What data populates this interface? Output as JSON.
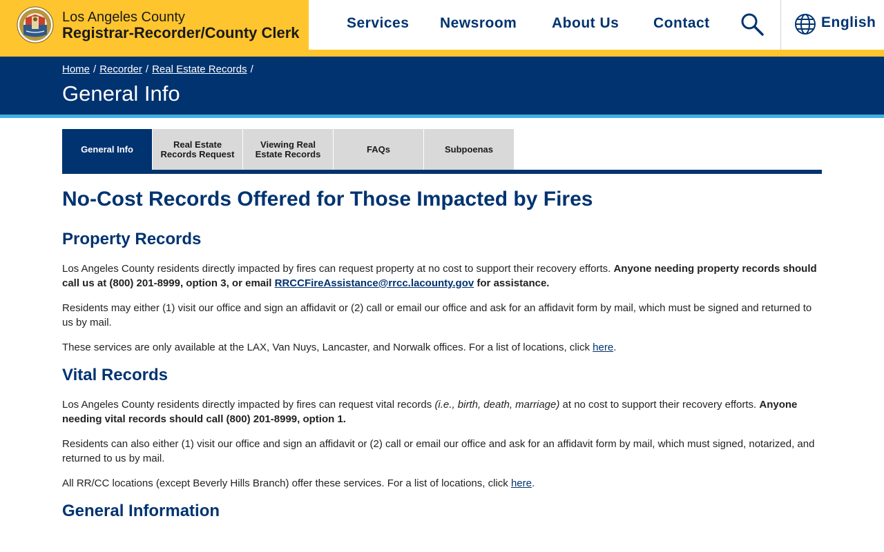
{
  "header": {
    "brand_line1": "Los Angeles County",
    "brand_line2": "Registrar-Recorder/County Clerk",
    "nav": [
      {
        "label": "Services"
      },
      {
        "label": "Newsroom"
      },
      {
        "label": "About Us"
      },
      {
        "label": "Contact"
      }
    ],
    "language": "English"
  },
  "banner": {
    "breadcrumbs": [
      "Home",
      "Recorder",
      "Real Estate Records"
    ],
    "separator": "/",
    "title": "General Info"
  },
  "tabs": [
    {
      "label": "General Info",
      "active": true
    },
    {
      "label": "Real Estate Records Request",
      "active": false
    },
    {
      "label": "Viewing Real Estate Records",
      "active": false
    },
    {
      "label": "FAQs",
      "active": false
    },
    {
      "label": "Subpoenas",
      "active": false
    }
  ],
  "content": {
    "heading": "No-Cost Records Offered for Those Impacted by Fires",
    "property": {
      "title": "Property Records",
      "p1_text": "Los Angeles County residents directly impacted by fires can request property at no cost to support their recovery efforts. ",
      "p1_bold_a": "Anyone needing property records should call us at (800) 201-8999, option 3, or email ",
      "p1_email": "RRCCFireAssistance@rrcc.lacounty.gov",
      "p1_bold_b": " for assistance.",
      "p2": "Residents may either (1) visit our office and sign an affidavit or (2) call or email our office and ask for an affidavit form by mail, which must be signed and returned to us by mail.",
      "p3_text": "These services are only available at the LAX, Van Nuys, Lancaster, and Norwalk offices. For a list of locations, click ",
      "p3_link": "here",
      "p3_end": "."
    },
    "vital": {
      "title": "Vital Records",
      "p1_text": "Los Angeles County residents directly impacted by fires can request vital records ",
      "p1_italic": "(i.e., birth, death, marriage)",
      "p1_text2": " at no cost to support their recovery efforts. ",
      "p1_bold": "Anyone needing vital records should call (800) 201-8999, option 1.",
      "p2": "Residents can also either (1) visit our office and sign an affidavit or (2) call or email our office and ask for an affidavit form by mail, which must signed, notarized, and returned to us by mail.",
      "p3_text": "All RR/CC locations (except Beverly Hills Branch) offer these services. For a list of locations, click ",
      "p3_link": "here",
      "p3_end": "."
    },
    "general": {
      "title": "General Information"
    }
  },
  "colors": {
    "brand_yellow": "#fec52e",
    "navy": "#003370",
    "accent_blue": "#42aee5",
    "tab_gray": "#d9d9d9"
  },
  "icons": [
    "county-seal-logo",
    "search-icon",
    "globe-icon"
  ]
}
